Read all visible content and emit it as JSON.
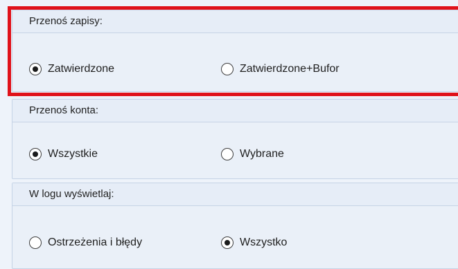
{
  "sections": [
    {
      "title": "Przenoś zapisy:",
      "options": [
        {
          "label": "Zatwierdzone",
          "checked": true
        },
        {
          "label": "Zatwierdzone+Bufor",
          "checked": false
        }
      ],
      "highlighted": true
    },
    {
      "title": "Przenoś konta:",
      "options": [
        {
          "label": "Wszystkie",
          "checked": true
        },
        {
          "label": "Wybrane",
          "checked": false
        }
      ],
      "highlighted": false
    },
    {
      "title": "W logu wyświetlaj:",
      "options": [
        {
          "label": "Ostrzeżenia i błędy",
          "checked": false
        },
        {
          "label": "Wszystko",
          "checked": true
        }
      ],
      "highlighted": false
    }
  ],
  "colors": {
    "highlight_border": "#e0121a",
    "panel_background": "#eaf0f8",
    "header_background": "#e6edf7",
    "page_background": "#eef3fa"
  }
}
